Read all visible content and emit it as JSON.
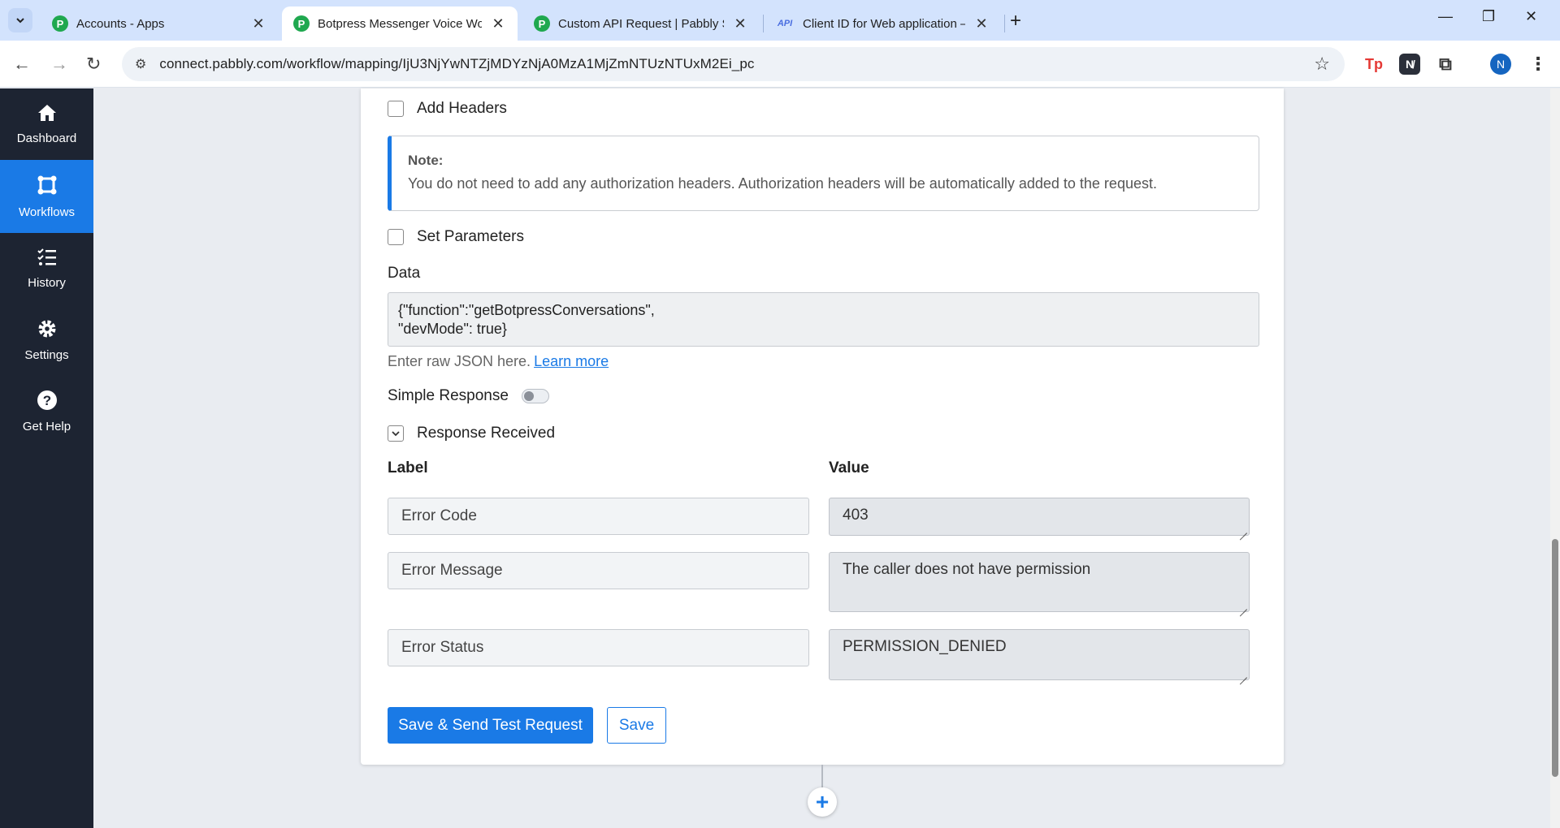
{
  "browser": {
    "tabs": [
      {
        "title": "Accounts - Apps",
        "favicon": "P",
        "active": false
      },
      {
        "title": "Botpress Messenger Voice Worl",
        "favicon": "P",
        "active": true
      },
      {
        "title": "Custom API Request | Pabbly Su",
        "favicon": "P",
        "active": false
      },
      {
        "title": "Client ID for Web application –",
        "favicon": "API",
        "active": false
      }
    ],
    "new_tab": "+",
    "window_controls": {
      "minimize": "—",
      "restore": "❐",
      "close": "✕"
    },
    "url": "connect.pabbly.com/workflow/mapping/IjU3NjYwNTZjMDYzNjA0MzA1MjZmNTUzNTUxM2Ei_pc",
    "extensions": {
      "tp": "Tp",
      "dark": "N̸",
      "avatar": "N"
    }
  },
  "sidebar": {
    "items": [
      {
        "label": "Dashboard",
        "icon": "home-icon",
        "active": false
      },
      {
        "label": "Workflows",
        "icon": "workflows-icon",
        "active": true
      },
      {
        "label": "History",
        "icon": "history-icon",
        "active": false
      },
      {
        "label": "Settings",
        "icon": "gear-icon",
        "active": false
      },
      {
        "label": "Get Help",
        "icon": "help-icon",
        "active": false
      }
    ]
  },
  "form": {
    "add_headers": "Add Headers",
    "note_title": "Note:",
    "note_text": "You do not need to add any authorization headers. Authorization headers will be automatically added to the request.",
    "set_parameters": "Set Parameters",
    "data_label": "Data",
    "data_line1": "{\"function\":\"getBotpressConversations\",",
    "data_line2": "\"devMode\": true}",
    "hint": "Enter raw JSON here.",
    "learn_more": "Learn more",
    "simple_response": "Simple Response",
    "simple_response_on": false,
    "response_received": "Response Received",
    "label_header": "Label",
    "value_header": "Value",
    "rows": [
      {
        "label": "Error Code",
        "value": "403"
      },
      {
        "label": "Error Message",
        "value": "The caller does not have permission"
      },
      {
        "label": "Error Status",
        "value": "PERMISSION_DENIED"
      }
    ],
    "save_send": "Save & Send Test Request",
    "save": "Save"
  },
  "colors": {
    "accent": "#1a7ae6",
    "sidebar_bg": "#1d2432",
    "tabstrip": "#d3e3fd"
  }
}
